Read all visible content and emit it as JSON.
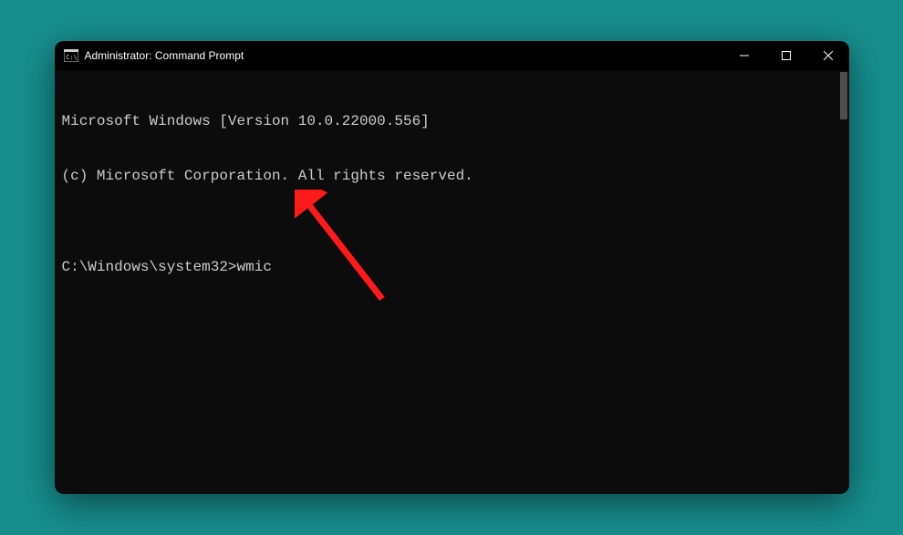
{
  "window": {
    "title": "Administrator: Command Prompt"
  },
  "console": {
    "line1": "Microsoft Windows [Version 10.0.22000.556]",
    "line2": "(c) Microsoft Corporation. All rights reserved.",
    "blank": "",
    "prompt": "C:\\Windows\\system32>",
    "command": "wmic"
  },
  "annotation": {
    "color": "#ff1a1a"
  }
}
